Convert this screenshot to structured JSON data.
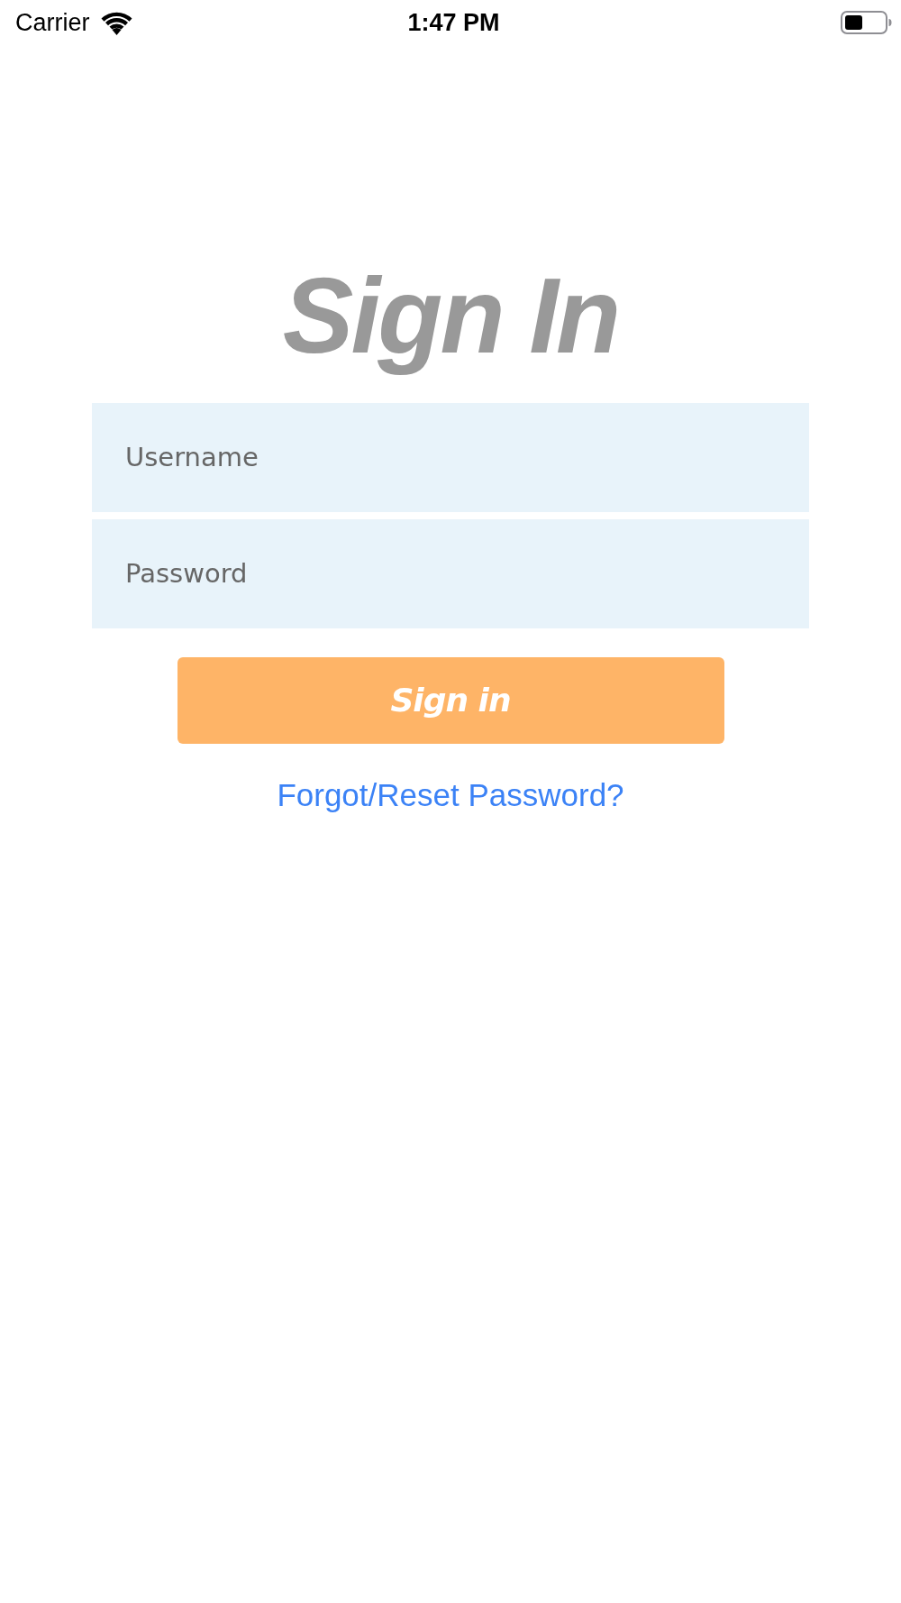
{
  "status_bar": {
    "carrier": "Carrier",
    "time": "1:47 PM"
  },
  "title": "Sign In",
  "fields": [
    {
      "placeholder": "Username"
    },
    {
      "placeholder": "Password"
    }
  ],
  "submit_button": {
    "label": "Sign in"
  },
  "forgot_link": {
    "label": "Forgot/Reset Password?"
  }
}
